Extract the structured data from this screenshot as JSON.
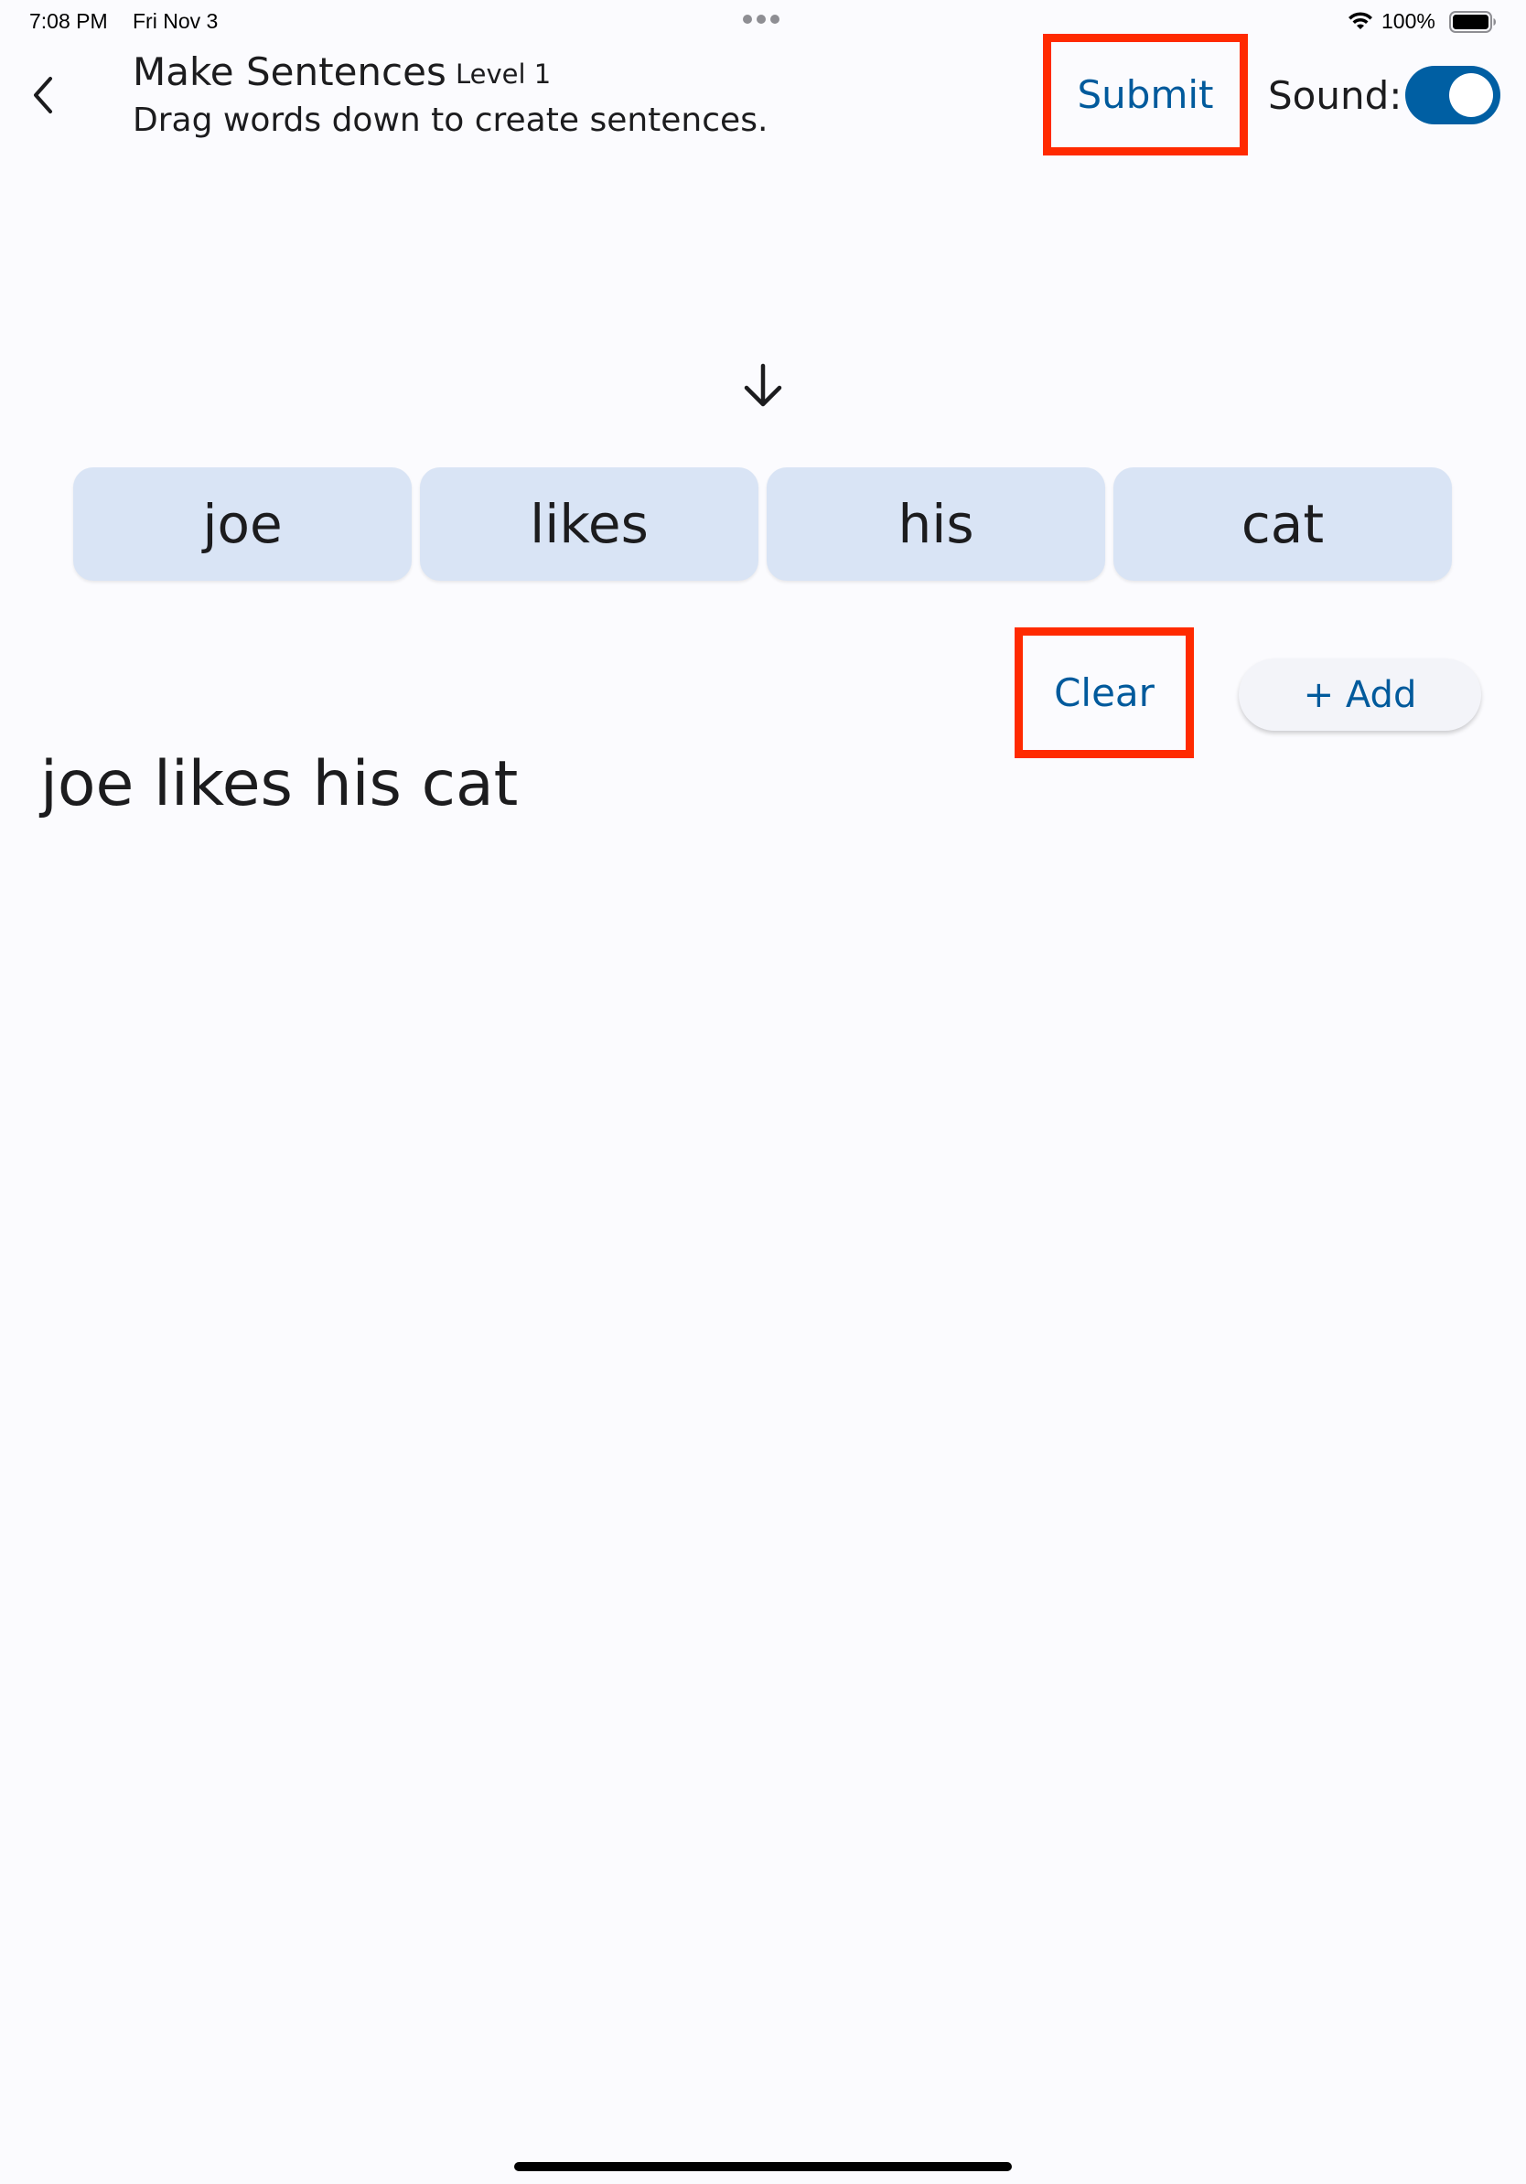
{
  "status_bar": {
    "time": "7:08 PM",
    "date": "Fri Nov 3",
    "battery": "100%",
    "wifi_icon": "wifi-icon",
    "battery_icon": "battery-full-icon"
  },
  "header": {
    "back_icon": "chevron-left-icon",
    "title": "Make Sentences",
    "level": "Level 1",
    "subtitle": "Drag words down to create sentences.",
    "submit_label": "Submit",
    "sound_label": "Sound:",
    "sound_on": true
  },
  "arrow_icon": "arrow-down-icon",
  "words": [
    "joe",
    "likes",
    "his",
    "cat"
  ],
  "actions": {
    "clear_label": "Clear",
    "add_label": "+ Add"
  },
  "sentence": "joe likes his cat",
  "colors": {
    "accent": "#005fa3",
    "highlight": "#ff2a00",
    "tile": "#d9e4f5",
    "background": "#fbfbfe"
  }
}
